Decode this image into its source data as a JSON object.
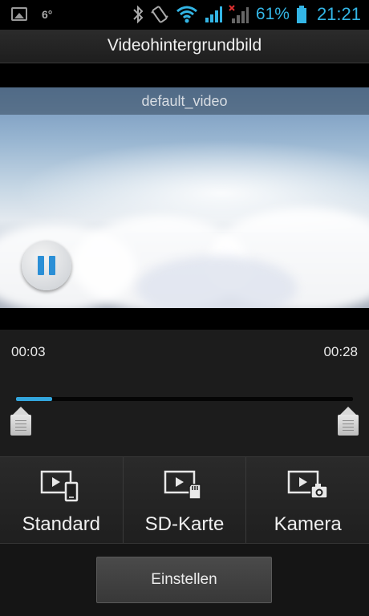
{
  "status_bar": {
    "temperature": "6°",
    "battery_percent": "61%",
    "time": "21:21",
    "icons": [
      "gallery-icon",
      "bluetooth-icon",
      "vibrate-icon",
      "wifi-icon",
      "signal-icon",
      "signal-no-sim-icon",
      "battery-icon"
    ],
    "accent_color": "#33b5e5"
  },
  "titlebar": {
    "title": "Videohintergrundbild"
  },
  "video": {
    "caption": "default_video",
    "state_icon": "pause-icon"
  },
  "player": {
    "elapsed": "00:03",
    "duration": "00:28",
    "progress_fraction": 0.107
  },
  "sources": [
    {
      "label": "Standard",
      "icon": "video-phone-icon"
    },
    {
      "label": "SD-Karte",
      "icon": "video-sdcard-icon"
    },
    {
      "label": "Kamera",
      "icon": "video-camera-icon"
    }
  ],
  "footer": {
    "set_label": "Einstellen"
  }
}
